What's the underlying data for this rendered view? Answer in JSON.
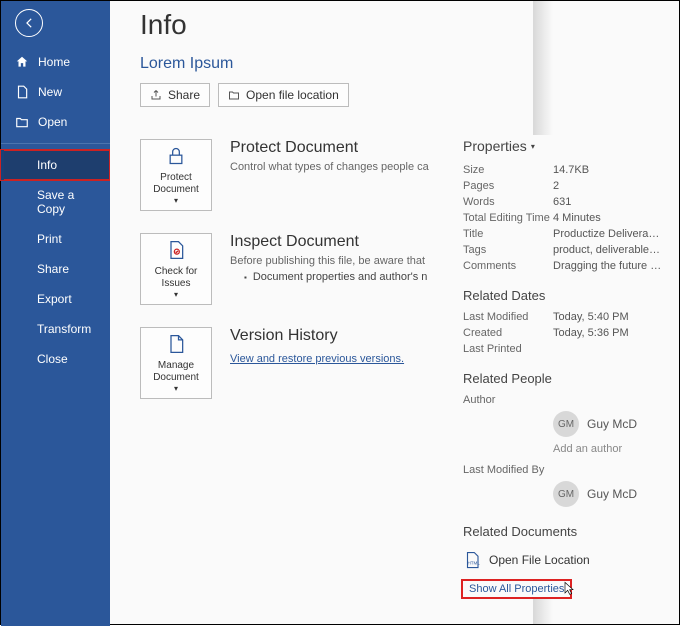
{
  "sidebar": {
    "home": "Home",
    "new": "New",
    "open": "Open",
    "info": "Info",
    "save_copy": "Save a Copy",
    "print": "Print",
    "share": "Share",
    "export": "Export",
    "transform": "Transform",
    "close": "Close"
  },
  "page": {
    "title": "Info",
    "doc_title": "Lorem Ipsum",
    "share_btn": "Share",
    "open_loc_btn": "Open file location"
  },
  "protect": {
    "btn": "Protect Document",
    "heading": "Protect Document",
    "desc": "Control what types of changes people ca"
  },
  "inspect": {
    "btn": "Check for Issues",
    "heading": "Inspect Document",
    "desc": "Before publishing this file, be aware that",
    "bullet": "Document properties and author's n"
  },
  "version": {
    "btn": "Manage Document",
    "heading": "Version History",
    "link": "View and restore previous versions."
  },
  "props": {
    "heading": "Properties",
    "size_k": "Size",
    "size_v": "14.7KB",
    "pages_k": "Pages",
    "pages_v": "2",
    "words_k": "Words",
    "words_v": "631",
    "edit_k": "Total Editing Time",
    "edit_v": "4 Minutes",
    "title_k": "Title",
    "title_v": "Productize Deliverables",
    "tags_k": "Tags",
    "tags_v": "product, deliverables, opti…",
    "comments_k": "Comments",
    "comments_v": "Dragging the future into n…"
  },
  "dates": {
    "heading": "Related Dates",
    "mod_k": "Last Modified",
    "mod_v": "Today, 5:40 PM",
    "created_k": "Created",
    "created_v": "Today, 5:36 PM",
    "printed_k": "Last Printed",
    "printed_v": ""
  },
  "people": {
    "heading": "Related People",
    "author_k": "Author",
    "author_initials": "GM",
    "author_name": "Guy McD",
    "add_author": "Add an author",
    "lastmod_k": "Last Modified By",
    "lastmod_initials": "GM",
    "lastmod_name": "Guy McD"
  },
  "rdocs": {
    "heading": "Related Documents",
    "open_loc": "Open File Location",
    "show_all": "Show All Properties"
  }
}
